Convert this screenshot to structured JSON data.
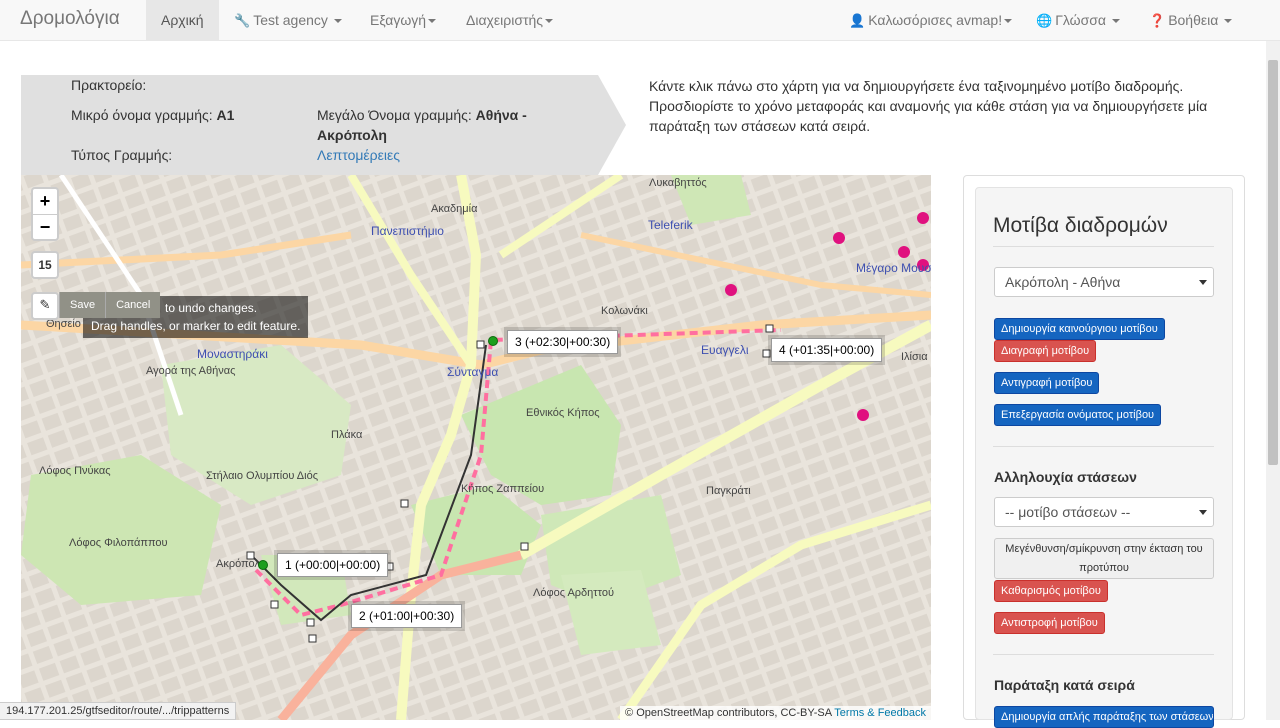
{
  "navbar": {
    "brand": "Δρομολόγια",
    "items": [
      {
        "label": "Αρχική",
        "active": true
      },
      {
        "label": "Test agency",
        "icon": "wrench-icon"
      },
      {
        "label": "Εξαγωγή"
      },
      {
        "label": "Διαχειριστής"
      }
    ],
    "right_items": [
      {
        "label": "Καλωσόρισες avmap!",
        "icon": "user-icon"
      },
      {
        "label": "Γλώσσα",
        "icon": "globe-icon"
      },
      {
        "label": "Βοήθεια",
        "icon": "question-circle-icon"
      }
    ]
  },
  "route_info": {
    "agency_label": "Πρακτορείο:",
    "short_name_label": "Μικρό όνομα γραμμής:",
    "short_name_value": "A1",
    "long_name_label": "Μεγάλο Όνομα γραμμής:",
    "long_name_value_1": "Αθήνα -",
    "long_name_value_2": "Ακρόπολη",
    "type_label": "Τύπος Γραμμής:",
    "details_link": "Λεπτομέρειες"
  },
  "instructions": "Κάντε κλικ πάνω στο χάρτη για να δημιουργήσετε ένα ταξινομημένο μοτίβο διαδρομής. Προσδιορίστε το χρόνο μεταφοράς και αναμονής για κάθε στάση για να δημιουργήσετε μία παράταξη των στάσεων κατά σειρά.",
  "map": {
    "zoom_in": "+",
    "zoom_out": "−",
    "zoom_level": "15",
    "edit_save": "Save",
    "edit_cancel": "Cancel",
    "edit_hint_1": "to undo changes.",
    "edit_hint_2": "Drag handles, or marker to edit feature.",
    "stops": [
      {
        "label": "1 (+00:00|+00:00)"
      },
      {
        "label": "2 (+01:00|+00:30)"
      },
      {
        "label": "3 (+02:30|+00:30)"
      },
      {
        "label": "4 (+01:35|+00:00)"
      }
    ],
    "place_labels": [
      "Πανεπιστήμιο",
      "Σύνταγμα",
      "Μοναστηράκι",
      "Ευαγγελι",
      "Μέγαρο Μουσικής",
      "Εθνικός Κήπος",
      "Κήπος Ζαππείου",
      "Λόφος Φιλοπάππου",
      "Λόφος Αρδηττού",
      "Ακρόπολη",
      "Στήλαιο Ολυμπίου Διός",
      "Λόφος Πνύκας",
      "Teleferik",
      "Αγορά της Αθήνας",
      "Ακαδημία",
      "Λυκαβηττός",
      "Πλάκα",
      "Θησείο",
      "Κολωνάκι",
      "Παγκράτι",
      "Ιλίσια"
    ],
    "attribution": "© OpenStreetMap contributors, CC-BY-SA",
    "attribution_link": "Terms & Feedback"
  },
  "status_url": "194.177.201.25/gtfseditor/route/.../trippatterns",
  "panel": {
    "title": "Μοτίβα διαδρομών",
    "pattern_select": "Ακρόπολη - Αθήνα",
    "create_pattern": "Δημιουργία καινούργιου μοτίβου",
    "delete_pattern": "Διαγραφή μοτίβου",
    "copy_pattern": "Αντιγραφή μοτίβου",
    "rename_pattern": "Επεξεργασία ονόματος μοτίβου",
    "stop_sequence_title": "Αλληλουχία στάσεων",
    "stop_pattern_select": "-- μοτίβο στάσεων --",
    "zoom_to_pattern": "Μεγένθυνση/σμίκρυνση στην έκταση του προτύπου",
    "clear_pattern": "Καθαρισμός μοτίβου",
    "reverse_pattern": "Αντιστροφή μοτίβου",
    "sequence_title": "Παράταξη κατά σειρά",
    "create_sequence": "Δημιουργία απλής παράταξης των στάσεων"
  }
}
